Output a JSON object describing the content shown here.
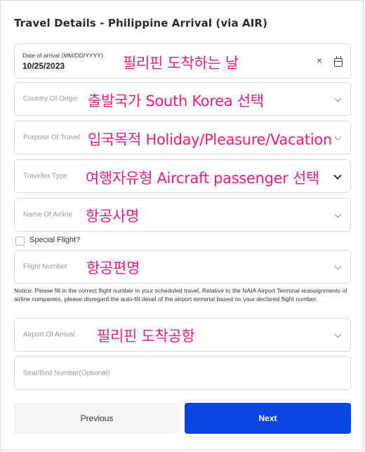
{
  "header": {
    "title": "Travel Details - Philippine Arrival (via AIR)"
  },
  "fields": {
    "date_of_arrival": {
      "label": "Date of arrival (MM/DD/YYYY)",
      "value": "10/25/2023",
      "clear_icon": "×",
      "annotation": "필리핀 도착하는 날"
    },
    "country_of_origin": {
      "placeholder": "Country Of Origin",
      "annotation": "출발국가 South Korea 선택"
    },
    "purpose_of_travel": {
      "placeholder": "Purpose Of Travel",
      "annotation": "입국목적 Holiday/Pleasure/Vacation"
    },
    "traveller_type": {
      "placeholder": "Traveller Type",
      "annotation": "여행자유형 Aircraft passenger 선택"
    },
    "name_of_airline": {
      "placeholder": "Name Of Airline",
      "annotation": "항공사명"
    },
    "special_flight": {
      "label": "Special Flight?",
      "checked": false
    },
    "flight_number": {
      "placeholder": "Flight Number",
      "annotation": "항공편명"
    },
    "airport_of_arrival": {
      "placeholder": "Airport Of Arrival",
      "annotation": "필리핀 도착공항"
    },
    "seat_bed_number": {
      "placeholder": "Seat/Bed Number(Optional)"
    }
  },
  "notice": "Notice: Please fill in the correct flight number in your scheduled travel. Relative to the NAIA Airport Terminal reassignments of airline companies, please disregard the auto-fill detail of the airport terminal based on your declared flight number.",
  "buttons": {
    "previous": "Previous",
    "next": "Next"
  },
  "colors": {
    "annotation": "#ec1c7e",
    "primary_button": "#0a45df"
  }
}
